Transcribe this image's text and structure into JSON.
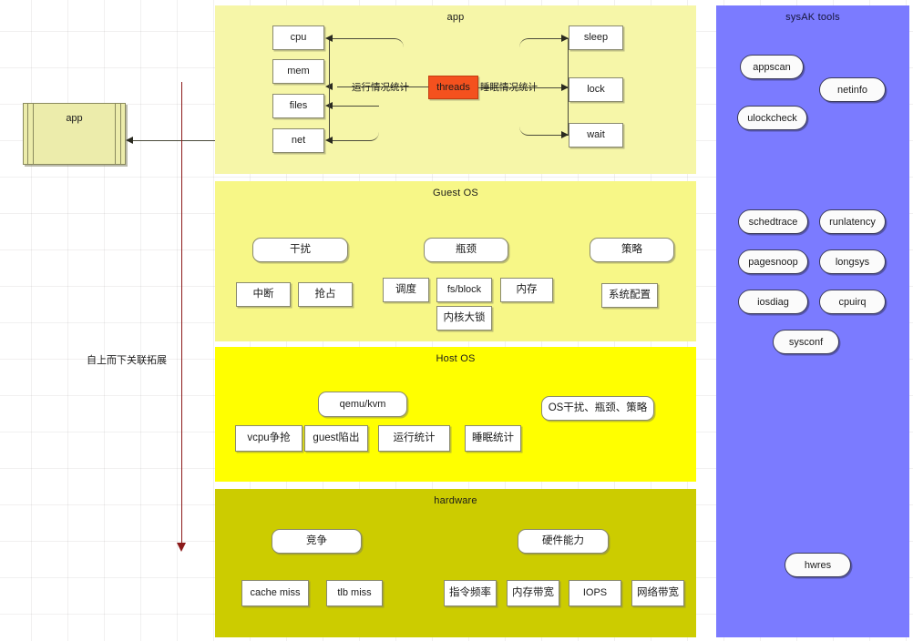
{
  "diagram": {
    "flow_note": "自上而下关联拓展",
    "external_component": {
      "label": "app"
    }
  },
  "layers": [
    {
      "id": "app",
      "title": "app",
      "color": "#f6f6a8",
      "left_nodes": [
        {
          "label": "cpu"
        },
        {
          "label": "mem"
        },
        {
          "label": "files"
        },
        {
          "label": "net"
        }
      ],
      "center_node": {
        "label": "threads",
        "color": "#f4511e"
      },
      "right_nodes": [
        {
          "label": "sleep"
        },
        {
          "label": "lock"
        },
        {
          "label": "wait"
        }
      ],
      "edge_labels": {
        "left": "运行情况统计",
        "right": "睡眠情况统计"
      }
    },
    {
      "id": "guest-os",
      "title": "Guest OS",
      "color": "#f7f787",
      "groups": [
        {
          "heading": "干扰",
          "items": [
            "中断",
            "抢占"
          ]
        },
        {
          "heading": "瓶颈",
          "items": [
            "调度",
            "fs/block",
            "内存",
            "内核大锁"
          ]
        },
        {
          "heading": "策略",
          "items": [
            "系统配置"
          ]
        }
      ]
    },
    {
      "id": "host-os",
      "title": "Host OS",
      "color": "#ffff00",
      "groups": [
        {
          "heading": "qemu/kvm",
          "items": [
            "vcpu争抢",
            "guest陷出",
            "运行统计",
            "睡眠统计"
          ]
        },
        {
          "heading": "OS干扰、瓶颈、策略",
          "items": []
        }
      ]
    },
    {
      "id": "hardware",
      "title": "hardware",
      "color": "#cccc00",
      "groups": [
        {
          "heading": "竞争",
          "items": [
            "cache miss",
            "tlb miss"
          ]
        },
        {
          "heading": "硬件能力",
          "items": [
            "指令频率",
            "内存带宽",
            "IOPS",
            "网络带宽"
          ]
        }
      ]
    }
  ],
  "sysak": {
    "title": "sysAK tools",
    "color": "#7b7bff",
    "tools": [
      {
        "label": "appscan"
      },
      {
        "label": "netinfo"
      },
      {
        "label": "ulockcheck"
      },
      {
        "label": "schedtrace"
      },
      {
        "label": "runlatency"
      },
      {
        "label": "pagesnoop"
      },
      {
        "label": "longsys"
      },
      {
        "label": "iosdiag"
      },
      {
        "label": "cpuirq"
      },
      {
        "label": "sysconf"
      },
      {
        "label": "hwres"
      }
    ]
  }
}
